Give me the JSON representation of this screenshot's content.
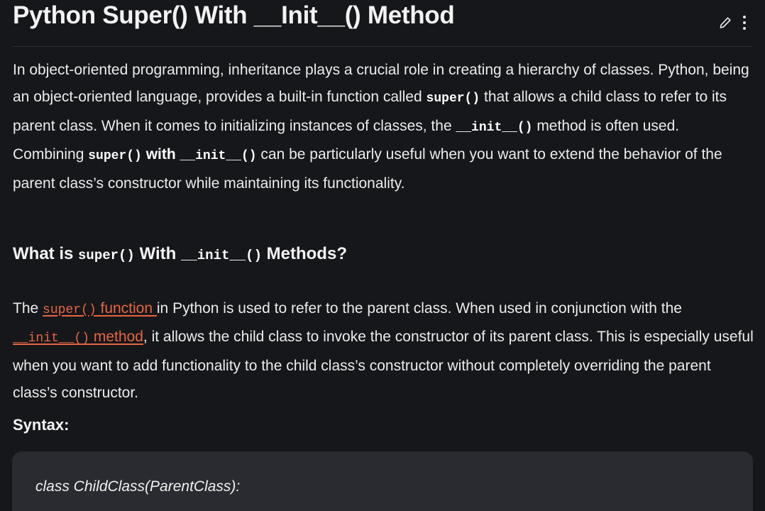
{
  "article": {
    "title": "Python Super() With __Init__() Method",
    "actions": {
      "edit_icon": "pencil-icon",
      "more_icon": "vertical-dots-icon"
    },
    "intro": {
      "t1": "In object-oriented programming, inheritance plays a crucial role in creating a hierarchy of classes. Python, being an object-oriented language, provides a built-in function called ",
      "c1": "super()",
      "t2": " that allows a child class to refer to its parent class. When it comes to initializing instances of classes, the ",
      "c2": "__init__()",
      "t3": " method is often used. Combining ",
      "c3": "super()",
      "b1": " with ",
      "c4": "__init__()",
      "t4": " can be particularly useful when you want to extend the behavior of the parent class’s constructor while maintaining its functionality."
    },
    "heading": {
      "t1": "What is ",
      "c1": "super()",
      "t2": " With ",
      "c2": "__init__()",
      "t3": " Methods?"
    },
    "body": {
      "t1": "The ",
      "link1_code": "super()",
      "link1_text": " function ",
      "t2": "in Python is used to refer to the parent class. When used in conjunction with the ",
      "link2_code": "__init__()",
      "link2_text": " method",
      "t3": ", it allows the child class to invoke the constructor of its parent class. This is especially useful when you want to add functionality to the child class’s constructor without completely overriding the parent class’s constructor."
    },
    "syntax_label": "Syntax:",
    "code_lines": [
      "class ChildClass(ParentClass):"
    ]
  },
  "colors": {
    "background": "#16171b",
    "link": "#e8653f",
    "code_block": "#2a2b30"
  }
}
